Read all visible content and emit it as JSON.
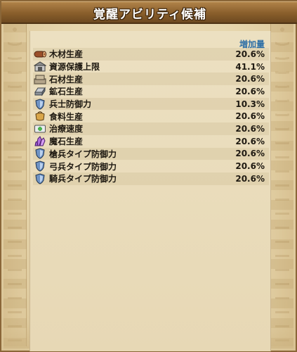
{
  "window": {
    "title": "覚醒アビリティ候補"
  },
  "table": {
    "header_value_label": "増加量",
    "rows": [
      {
        "name": "木材生産",
        "value": "20.6%",
        "icon": "wood-icon"
      },
      {
        "name": "資源保護上限",
        "value": "41.1%",
        "icon": "warehouse-icon"
      },
      {
        "name": "石材生産",
        "value": "20.6%",
        "icon": "stone-icon"
      },
      {
        "name": "鉱石生産",
        "value": "20.6%",
        "icon": "ore-icon"
      },
      {
        "name": "兵士防御力",
        "value": "10.3%",
        "icon": "shield-icon"
      },
      {
        "name": "食料生産",
        "value": "20.6%",
        "icon": "food-icon"
      },
      {
        "name": "治療速度",
        "value": "20.6%",
        "icon": "heal-icon"
      },
      {
        "name": "魔石生産",
        "value": "20.6%",
        "icon": "crystal-icon"
      },
      {
        "name": "槍兵タイプ防御力",
        "value": "20.6%",
        "icon": "shield-icon"
      },
      {
        "name": "弓兵タイプ防御力",
        "value": "20.6%",
        "icon": "shield-icon"
      },
      {
        "name": "騎兵タイプ防御力",
        "value": "20.6%",
        "icon": "shield-icon"
      }
    ]
  }
}
